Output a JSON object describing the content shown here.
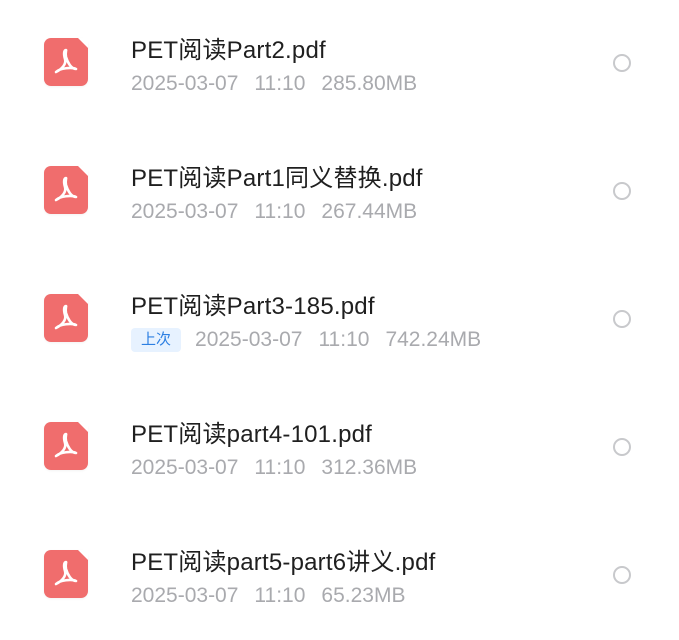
{
  "files": [
    {
      "name": "PET阅读Part2.pdf",
      "date": "2025-03-07",
      "time": "11:10",
      "size": "285.80MB",
      "badge": "",
      "icon": "pdf-file-icon",
      "selected": false
    },
    {
      "name": "PET阅读Part1同义替换.pdf",
      "date": "2025-03-07",
      "time": "11:10",
      "size": "267.44MB",
      "badge": "",
      "icon": "pdf-file-icon",
      "selected": false
    },
    {
      "name": "PET阅读Part3-185.pdf",
      "date": "2025-03-07",
      "time": "11:10",
      "size": "742.24MB",
      "badge": "上次",
      "icon": "pdf-file-icon",
      "selected": false
    },
    {
      "name": "PET阅读part4-101.pdf",
      "date": "2025-03-07",
      "time": "11:10",
      "size": "312.36MB",
      "badge": "",
      "icon": "pdf-file-icon",
      "selected": false
    },
    {
      "name": "PET阅读part5-part6讲义.pdf",
      "date": "2025-03-07",
      "time": "11:10",
      "size": "65.23MB",
      "badge": "",
      "icon": "pdf-file-icon",
      "selected": false
    }
  ],
  "colors": {
    "pdf_icon": "#f06d6d",
    "file_name": "#1f1f1f",
    "meta_text": "#a9aaae",
    "badge_bg": "#e7f2ff",
    "badge_text": "#2c7fe2",
    "radio_border": "#c8c9cc"
  }
}
